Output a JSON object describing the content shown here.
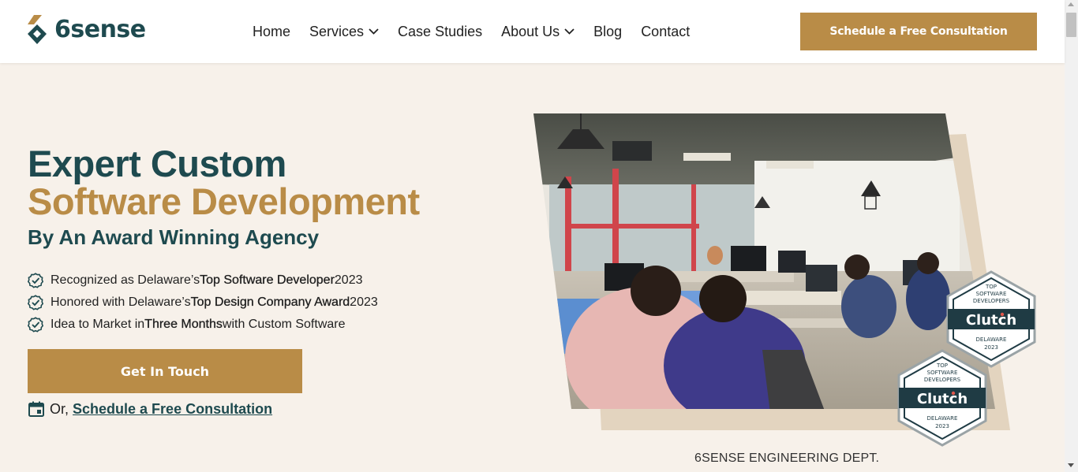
{
  "header": {
    "logo_text": "6sense",
    "nav": [
      {
        "label": "Home",
        "has_dropdown": false
      },
      {
        "label": "Services",
        "has_dropdown": true
      },
      {
        "label": "Case Studies",
        "has_dropdown": false
      },
      {
        "label": "About Us",
        "has_dropdown": true
      },
      {
        "label": "Blog",
        "has_dropdown": false
      },
      {
        "label": "Contact",
        "has_dropdown": false
      }
    ],
    "cta_label": "Schedule a Free Consultation"
  },
  "hero": {
    "title_line1": "Expert Custom",
    "title_line2": "Software Development",
    "subtitle": "By An Award Winning Agency",
    "features": [
      {
        "pre": "Recognized as Delaware’s ",
        "bold": "Top Software Developer",
        "post": " 2023"
      },
      {
        "pre": "Honored with Delaware’s ",
        "bold": "Top Design Company Award",
        "post": " 2023"
      },
      {
        "pre": "Idea to Market in ",
        "bold": "Three Months",
        "post": " with Custom Software"
      }
    ],
    "cta_label": "Get In Touch",
    "schedule_prefix": "Or,",
    "schedule_link": "Schedule a Free Consultation"
  },
  "image": {
    "caption": "6SENSE ENGINEERING DEPT.",
    "badges": [
      {
        "top1": "TOP",
        "top2": "SOFTWARE",
        "top3": "DEVELOPERS",
        "brand": "Clutch",
        "region": "DELAWARE",
        "year": "2023"
      },
      {
        "top1": "TOP",
        "top2": "SOFTWARE",
        "top3": "DEVELOPERS",
        "brand": "Clutch",
        "region": "DELAWARE",
        "year": "2023"
      }
    ]
  },
  "colors": {
    "brand_teal": "#1e4a4f",
    "brand_gold": "#b98c47",
    "page_bg": "#f7f1ea",
    "frame_beige": "#e3d4bf"
  }
}
